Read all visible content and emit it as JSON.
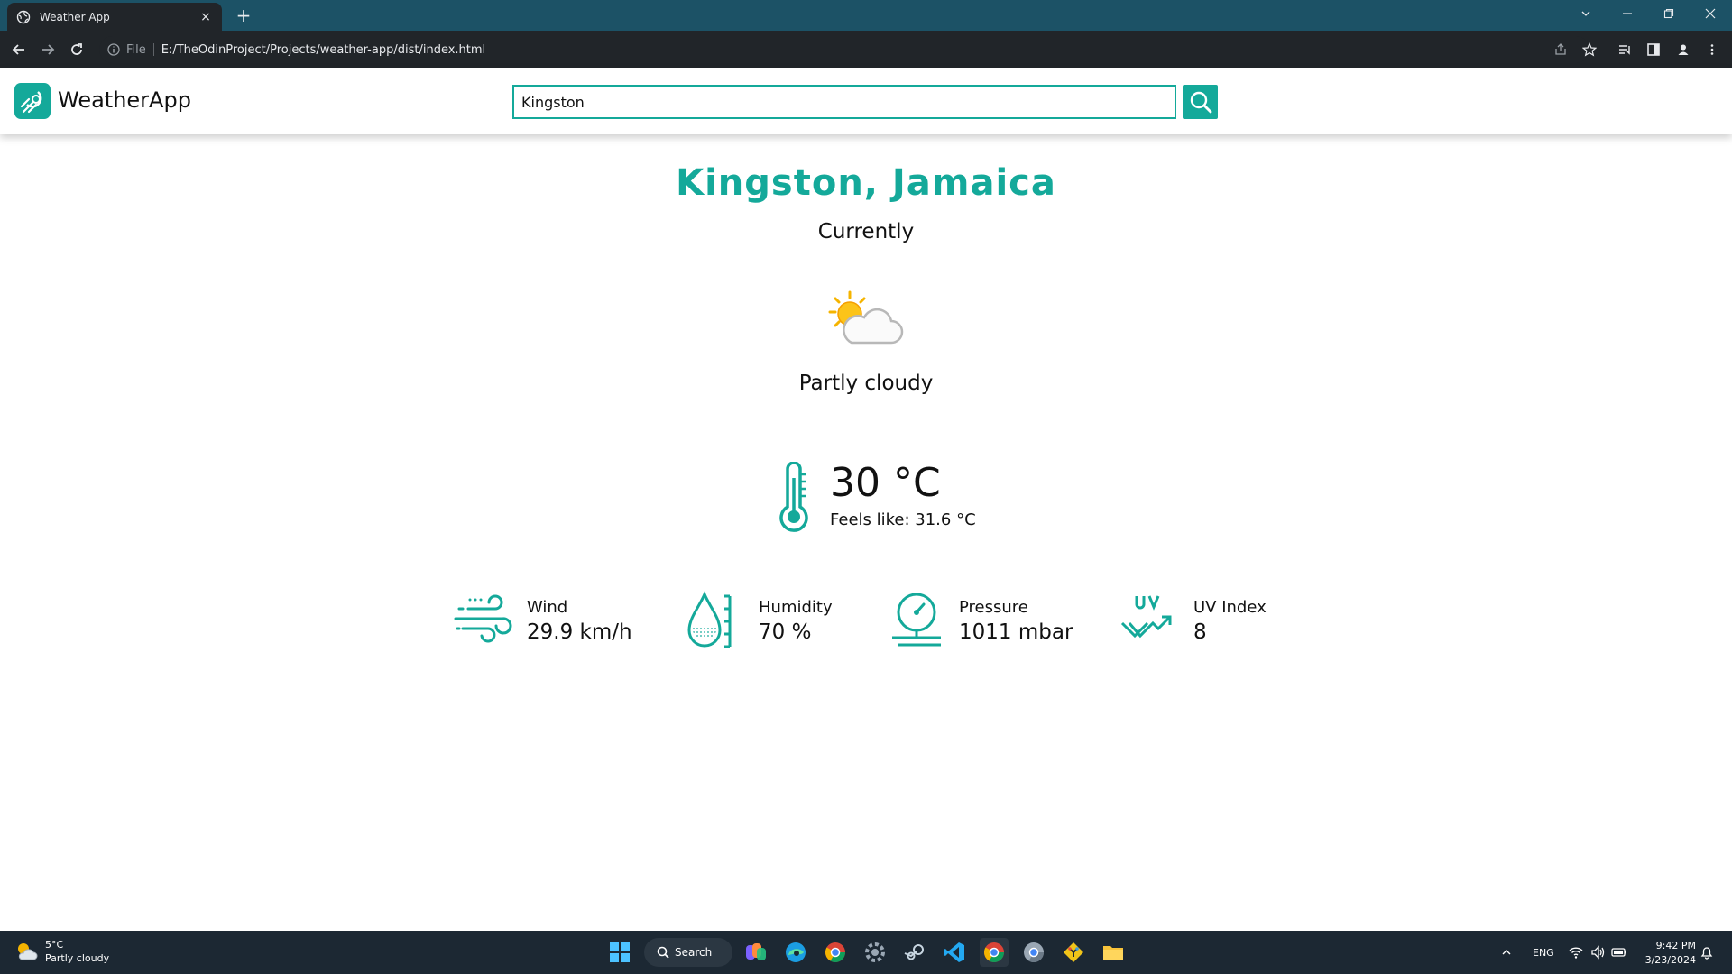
{
  "browser": {
    "tab_title": "Weather App",
    "tab_close": "×",
    "new_tab": "+",
    "url_scheme": "File",
    "url": "E:/TheOdinProject/Projects/weather-app/dist/index.html"
  },
  "app": {
    "brand": "WeatherApp",
    "search_value": "Kingston",
    "accent_color": "#14a99a"
  },
  "weather": {
    "location": "Kingston, Jamaica",
    "period": "Currently",
    "condition": "Partly cloudy",
    "temperature": "30 °C",
    "feels_like_label": "Feels like:",
    "feels_like_value": "31.6 °C",
    "stats": [
      {
        "label": "Wind",
        "value": "29.9 km/h",
        "icon": "wind-icon"
      },
      {
        "label": "Humidity",
        "value": "70 %",
        "icon": "humidity-icon"
      },
      {
        "label": "Pressure",
        "value": "1011 mbar",
        "icon": "pressure-icon"
      },
      {
        "label": "UV Index",
        "value": "8",
        "icon": "uv-icon"
      }
    ]
  },
  "taskbar": {
    "weather_temp": "5°C",
    "weather_cond": "Partly cloudy",
    "search_label": "Search",
    "language": "ENG",
    "time": "9:42 PM",
    "date": "3/23/2024"
  }
}
